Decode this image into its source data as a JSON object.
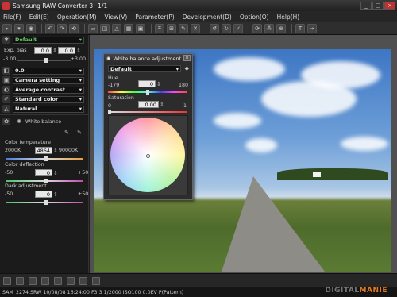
{
  "window": {
    "title": "Samsung RAW Converter 3",
    "counter": "1/1"
  },
  "menu": [
    "File(F)",
    "Edit(E)",
    "Operation(M)",
    "View(V)",
    "Parameter(P)",
    "Development(D)",
    "Option(O)",
    "Help(H)"
  ],
  "left_panel": {
    "preset": "Default",
    "exp_bias_label": "Exp. bias",
    "exp_bias_value1": "0.0",
    "exp_bias_value2": "0.0",
    "exp_min": "-3.00",
    "exp_max": "+3.00",
    "value_dd": "0.0",
    "camera_setting": "Camera setting",
    "contrast": "Average contrast",
    "color": "Standard color",
    "natural": "Natural",
    "wb_tab": "White balance",
    "color_temp_label": "Color temperature",
    "color_temp_min": "2000K",
    "color_temp_value": "4864",
    "color_temp_max": "90000K",
    "color_deflection_label": "Color deflection",
    "cd_min": "-50",
    "cd_value": "0",
    "cd_max": "+50",
    "dark_adj_label": "Dark adjustment",
    "da_min": "-50",
    "da_value": "0",
    "da_max": "+50"
  },
  "dialog": {
    "title": "White balance adjustment",
    "preset": "Default",
    "hue_label": "Hue",
    "hue_min": "-179",
    "hue_value": "0",
    "hue_max": "180",
    "sat_label": "Saturation",
    "sat_min": "0",
    "sat_value": "0.00",
    "sat_max": "1"
  },
  "status": "SAM_2274.SRW 10/08/08 16:24:00 F3.3 1/2000 ISO100 0.0EV P(Pattern)",
  "watermark_a": "DIGITAL",
  "watermark_b": "MANIE"
}
